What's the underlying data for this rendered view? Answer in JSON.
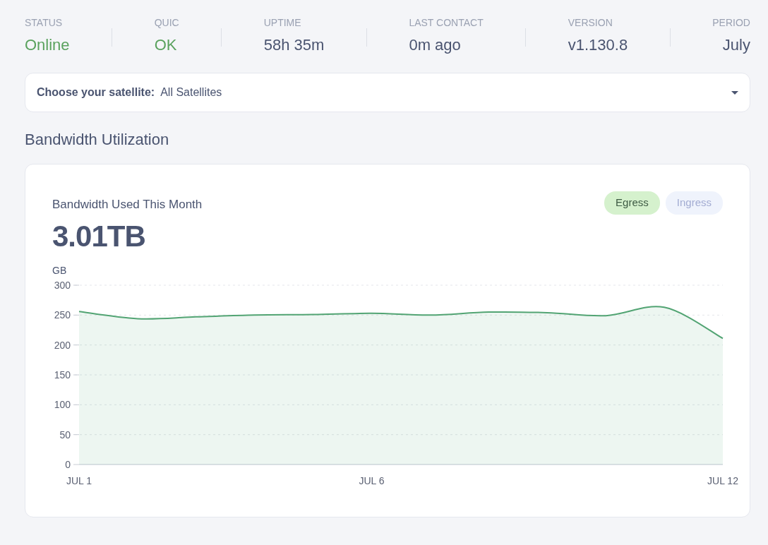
{
  "stats": [
    {
      "label": "STATUS",
      "value": "Online",
      "color": "#5aa25e"
    },
    {
      "label": "QUIC",
      "value": "OK",
      "color": "#5aa25e"
    },
    {
      "label": "UPTIME",
      "value": "58h 35m",
      "color": "#4a5470"
    },
    {
      "label": "LAST CONTACT",
      "value": "0m ago",
      "color": "#4a5470"
    },
    {
      "label": "VERSION",
      "value": "v1.130.8",
      "color": "#4a5470"
    },
    {
      "label": "PERIOD",
      "value": "July",
      "color": "#4a5470"
    }
  ],
  "satellite_select": {
    "label": "Choose your satellite:",
    "value": "All Satellites"
  },
  "section_title": "Bandwidth Utilization",
  "bandwidth_card": {
    "title": "Bandwidth Used This Month",
    "total": "3.01TB",
    "toggles": [
      {
        "label": "Egress",
        "selected": true
      },
      {
        "label": "Ingress",
        "selected": false
      }
    ],
    "chart_data": {
      "type": "area",
      "ylabel": "GB",
      "categories": [
        "JUL 1",
        null,
        null,
        null,
        null,
        "JUL 6",
        null,
        null,
        null,
        null,
        null,
        "JUL 12"
      ],
      "ylim": [
        0,
        300
      ],
      "grid": true,
      "yticks": [
        0,
        50,
        100,
        150,
        200,
        250,
        300
      ],
      "series": [
        {
          "color": "#52a473",
          "values": [
            256,
            244,
            247,
            250,
            251,
            253,
            250,
            255,
            254,
            249,
            263,
            211
          ]
        }
      ]
    }
  }
}
